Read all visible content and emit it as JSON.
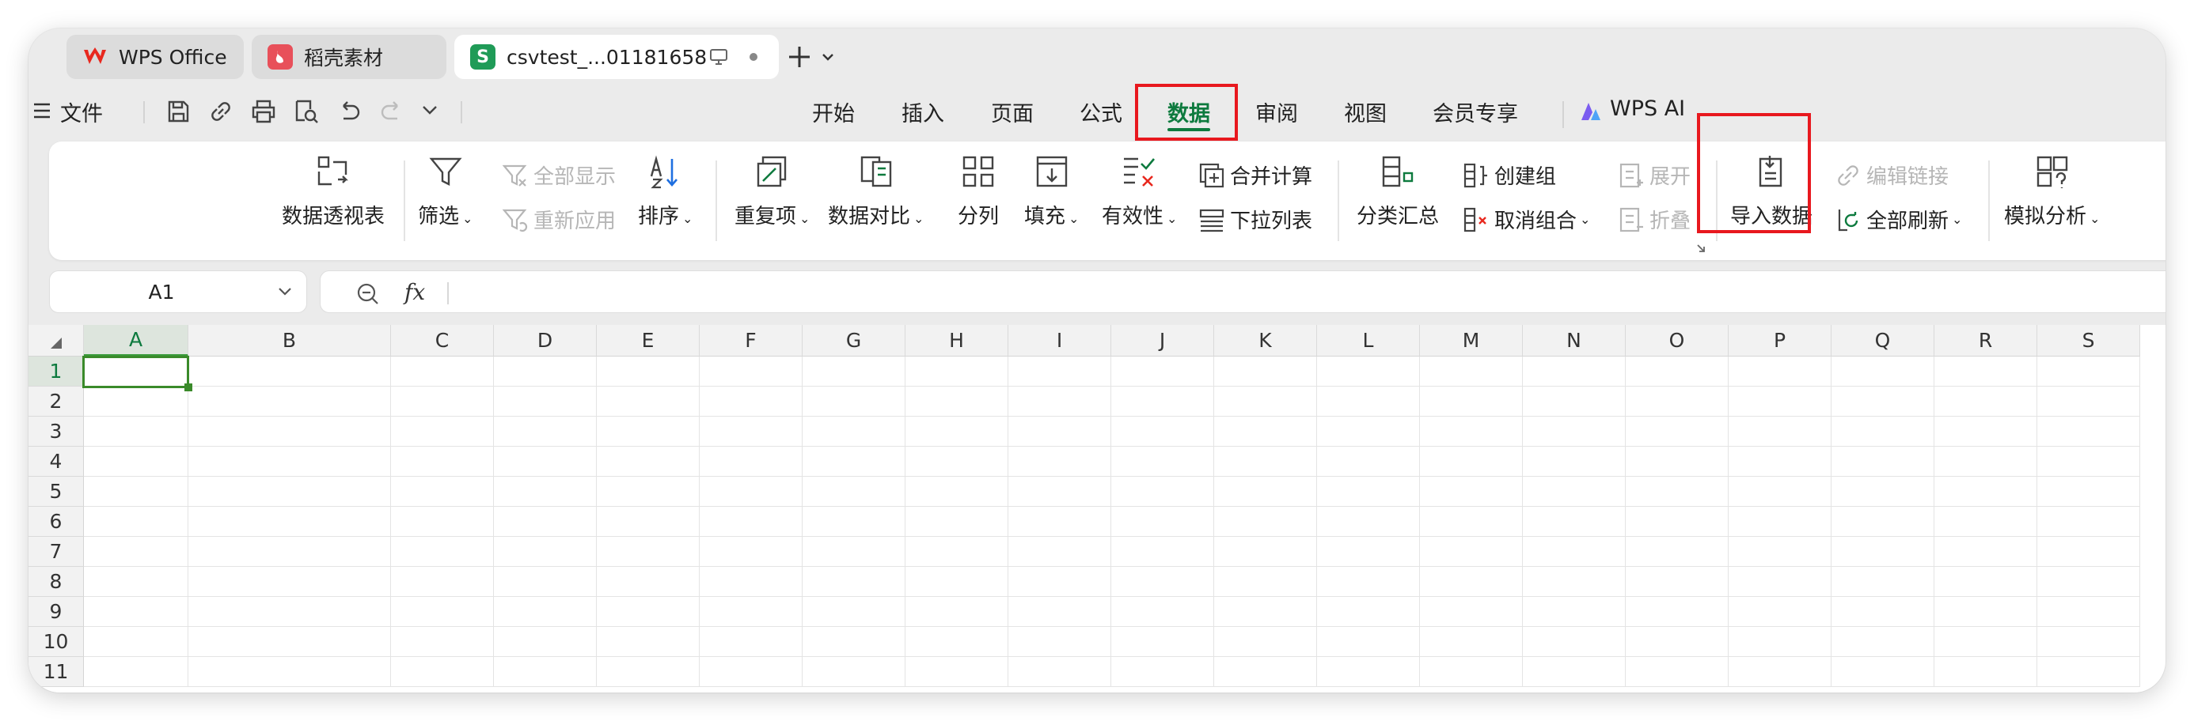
{
  "tabs": [
    {
      "label": "WPS Office",
      "icon": "wps-logo-icon",
      "active": false
    },
    {
      "label": "稻壳素材",
      "icon": "docer-icon",
      "active": false
    },
    {
      "label": "csvtest_...01181658",
      "icon": "spreadsheet-icon",
      "icon_letter": "S",
      "active": true
    }
  ],
  "menu": {
    "file_label": "文件",
    "items": [
      "开始",
      "插入",
      "页面",
      "公式",
      "数据",
      "审阅",
      "视图",
      "会员专享"
    ],
    "active_item": "数据",
    "ai_label": "WPS AI"
  },
  "ribbon": {
    "pivot": "数据透视表",
    "filter": "筛选",
    "show_all": "全部显示",
    "reapply": "重新应用",
    "sort": "排序",
    "duplicates": "重复项",
    "compare": "数据对比",
    "split": "分列",
    "fill": "填充",
    "validity": "有效性",
    "consolidate": "合并计算",
    "dropdown_list": "下拉列表",
    "subtotal": "分类汇总",
    "create_group": "创建组",
    "ungroup": "取消组合",
    "expand": "展开",
    "collapse": "折叠",
    "import_data": "导入数据",
    "edit_links": "编辑链接",
    "refresh_all": "全部刷新",
    "what_if": "模拟分析"
  },
  "formula_bar": {
    "name_box": "A1",
    "fx_label": "fx",
    "value": ""
  },
  "grid": {
    "columns": [
      "A",
      "B",
      "C",
      "D",
      "E",
      "F",
      "G",
      "H",
      "I",
      "J",
      "K",
      "L",
      "M",
      "N",
      "O",
      "P",
      "Q",
      "R",
      "S"
    ],
    "rows": [
      "1",
      "2",
      "3",
      "4",
      "5",
      "6",
      "7",
      "8",
      "9",
      "10",
      "11"
    ],
    "selected_cell": "A1"
  },
  "colors": {
    "accent_green": "#0d7a3e",
    "highlight_red": "#e8181e",
    "wps_red": "#e8281e"
  }
}
